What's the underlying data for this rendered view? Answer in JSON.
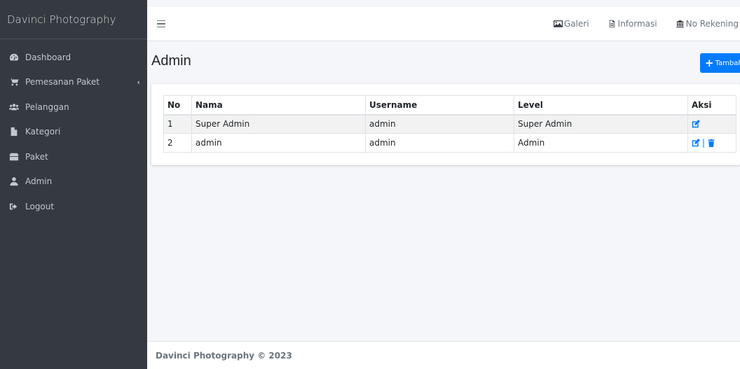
{
  "sidebar": {
    "brand": "Davinci Photography",
    "items": [
      {
        "label": "Dashboard",
        "icon": "tachometer-icon"
      },
      {
        "label": "Pemesanan Paket",
        "icon": "shopping-cart-icon"
      },
      {
        "label": "Pelanggan",
        "icon": "users-icon"
      },
      {
        "label": "Kategori",
        "icon": "file-icon"
      },
      {
        "label": "Paket",
        "icon": "box-icon"
      },
      {
        "label": "Admin",
        "icon": "user-icon"
      },
      {
        "label": "Logout",
        "icon": "sign-out-icon"
      }
    ]
  },
  "topbar": {
    "links": [
      {
        "label": "Galeri",
        "icon": "image-icon"
      },
      {
        "label": "Informasi",
        "icon": "file-text-icon"
      },
      {
        "label": "No Rekening",
        "icon": "bank-icon"
      }
    ]
  },
  "page": {
    "title": "Admin",
    "add_label": "Tambah"
  },
  "table": {
    "headers": [
      "No",
      "Nama",
      "Username",
      "Level",
      "Aksi"
    ],
    "rows": [
      {
        "no": "1",
        "nama": "Super Admin",
        "username": "admin",
        "level": "Super Admin"
      },
      {
        "no": "2",
        "nama": "admin",
        "username": "admin",
        "level": "Admin"
      }
    ]
  },
  "footer": {
    "text": "Davinci Photography © 2023"
  },
  "colors": {
    "sidebar_bg": "#343a40",
    "primary": "#007bff",
    "content_bg": "#f4f6f9"
  }
}
